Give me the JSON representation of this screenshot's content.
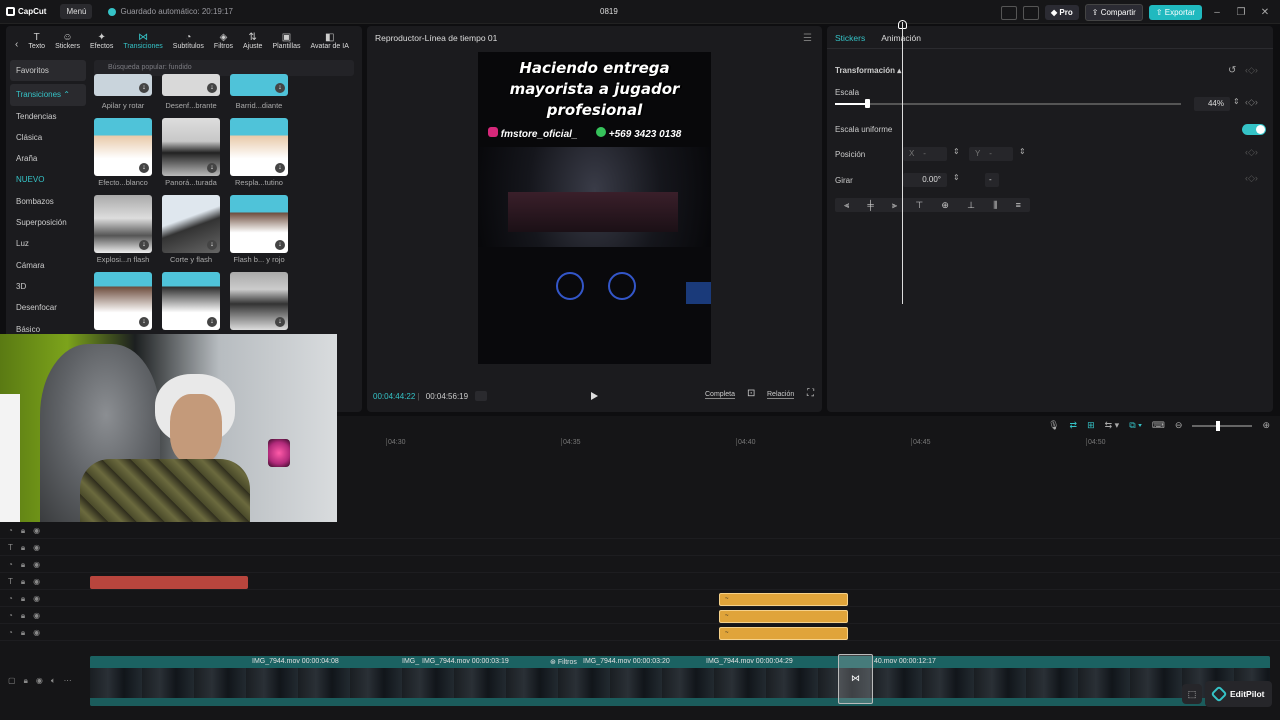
{
  "topbar": {
    "app": "CapCut",
    "menu": "Menú",
    "autosave": "Guardado automático: 20:19:17",
    "project": "0819",
    "pro": "Pro",
    "share": "Compartir",
    "export": "Exportar"
  },
  "tools": [
    {
      "icon": "T",
      "label": "Texto"
    },
    {
      "icon": "☺",
      "label": "Stickers"
    },
    {
      "icon": "✦",
      "label": "Efectos"
    },
    {
      "icon": "⋈",
      "label": "Transiciones"
    },
    {
      "icon": "◔",
      "label": "Subtítulos"
    },
    {
      "icon": "◈",
      "label": "Filtros"
    },
    {
      "icon": "⇅",
      "label": "Ajuste"
    },
    {
      "icon": "▣",
      "label": "Plantillas"
    },
    {
      "icon": "◧",
      "label": "Avatar de IA"
    }
  ],
  "sidebar": [
    "Favoritos",
    "Transiciones",
    "Tendencias",
    "Clásica",
    "Araña",
    "NUEVO",
    "Bombazos",
    "Superposición",
    "Luz",
    "Cámara",
    "3D",
    "Desenfocar",
    "Básico"
  ],
  "search": {
    "placeholder": "Búsqueda popular: fundido"
  },
  "grid": {
    "labels": [
      "Apilar y rotar",
      "Desenf...brante",
      "Barrid...diante",
      "Efecto...blanco",
      "Panorá...turada",
      "Respla...tutino",
      "Explosi...n flash",
      "Corte y flash",
      "Flash b... y rojo"
    ]
  },
  "player": {
    "title": "Reproductor-Línea de tiempo 01",
    "overlay_line1": "Haciendo entrega",
    "overlay_line2": "mayorista a jugador",
    "overlay_line3": "profesional",
    "instagram": "fmstore_oficial_",
    "phone": "+569 3423 0138",
    "current": "00:04:44:22",
    "total": "00:04:56:19",
    "complete": "Completa",
    "ratio": "Relación"
  },
  "right": {
    "tab_stickers": "Stickers",
    "tab_anim": "Animación",
    "transform": "Transformación",
    "scale": "Escala",
    "scale_value": "44%",
    "scale_level": 0.44,
    "uniform": "Escala uniforme",
    "position": "Posición",
    "pos_x": "X",
    "pos_x_val": "-",
    "pos_y": "Y",
    "pos_y_val": "-",
    "rotate": "Girar",
    "rotate_val": "0.00°",
    "rotate_dash": "-"
  },
  "timeline": {
    "ruler": [
      "04:30",
      "04:35",
      "04:40",
      "04:45",
      "04:50"
    ],
    "clips": [
      {
        "label": "IMG_7944.mov   00:00:04:08"
      },
      {
        "label": "IMG_"
      },
      {
        "label": "IMG_7944.mov   00:00:03:19"
      },
      {
        "label": "Filtros"
      },
      {
        "label": "IMG_7944.mov   00:00:03:20"
      },
      {
        "label": "IMG_7944.mov   00:00:04:29"
      },
      {
        "label": "40.mov   00:00:12:17"
      }
    ]
  },
  "editpilot": "EditPilot"
}
